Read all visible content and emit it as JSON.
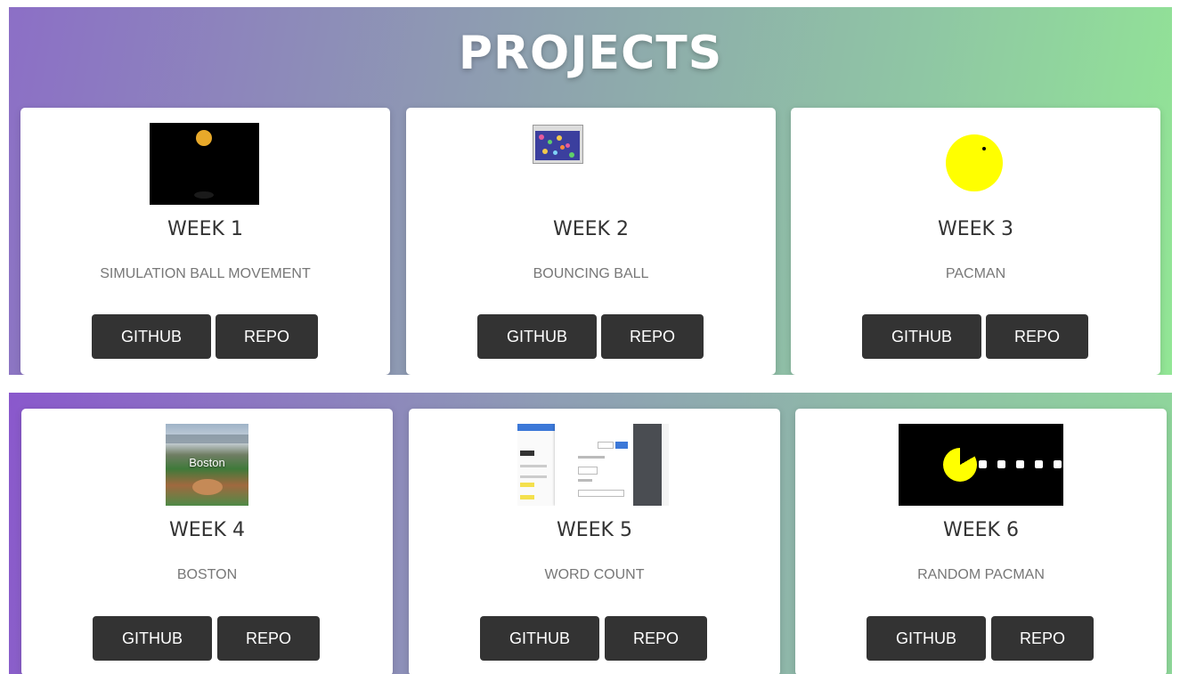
{
  "page": {
    "title": "PROJECTS"
  },
  "projects": [
    {
      "week": "WEEK 1",
      "name": "SIMULATION BALL MOVEMENT",
      "github": "GITHUB",
      "repo": "REPO",
      "thumb_icon": "ball-simulation-image"
    },
    {
      "week": "WEEK 2",
      "name": "BOUNCING BALL",
      "github": "GITHUB",
      "repo": "REPO",
      "thumb_icon": "bouncing-balls-image"
    },
    {
      "week": "WEEK 3",
      "name": "PACMAN",
      "github": "GITHUB",
      "repo": "REPO",
      "thumb_icon": "pacman-image"
    },
    {
      "week": "WEEK 4",
      "name": "BOSTON",
      "github": "GITHUB",
      "repo": "REPO",
      "thumb_icon": "boston-stadium-image",
      "thumb_caption": "Boston"
    },
    {
      "week": "WEEK 5",
      "name": "WORD COUNT",
      "github": "GITHUB",
      "repo": "REPO",
      "thumb_icon": "print-dialog-image"
    },
    {
      "week": "WEEK 6",
      "name": "RANDOM PACMAN",
      "github": "GITHUB",
      "repo": "REPO",
      "thumb_icon": "pacman-dots-image"
    }
  ],
  "colors": {
    "button": "#333333",
    "ball": "#e8a92a",
    "pacman": "#ffff00"
  }
}
